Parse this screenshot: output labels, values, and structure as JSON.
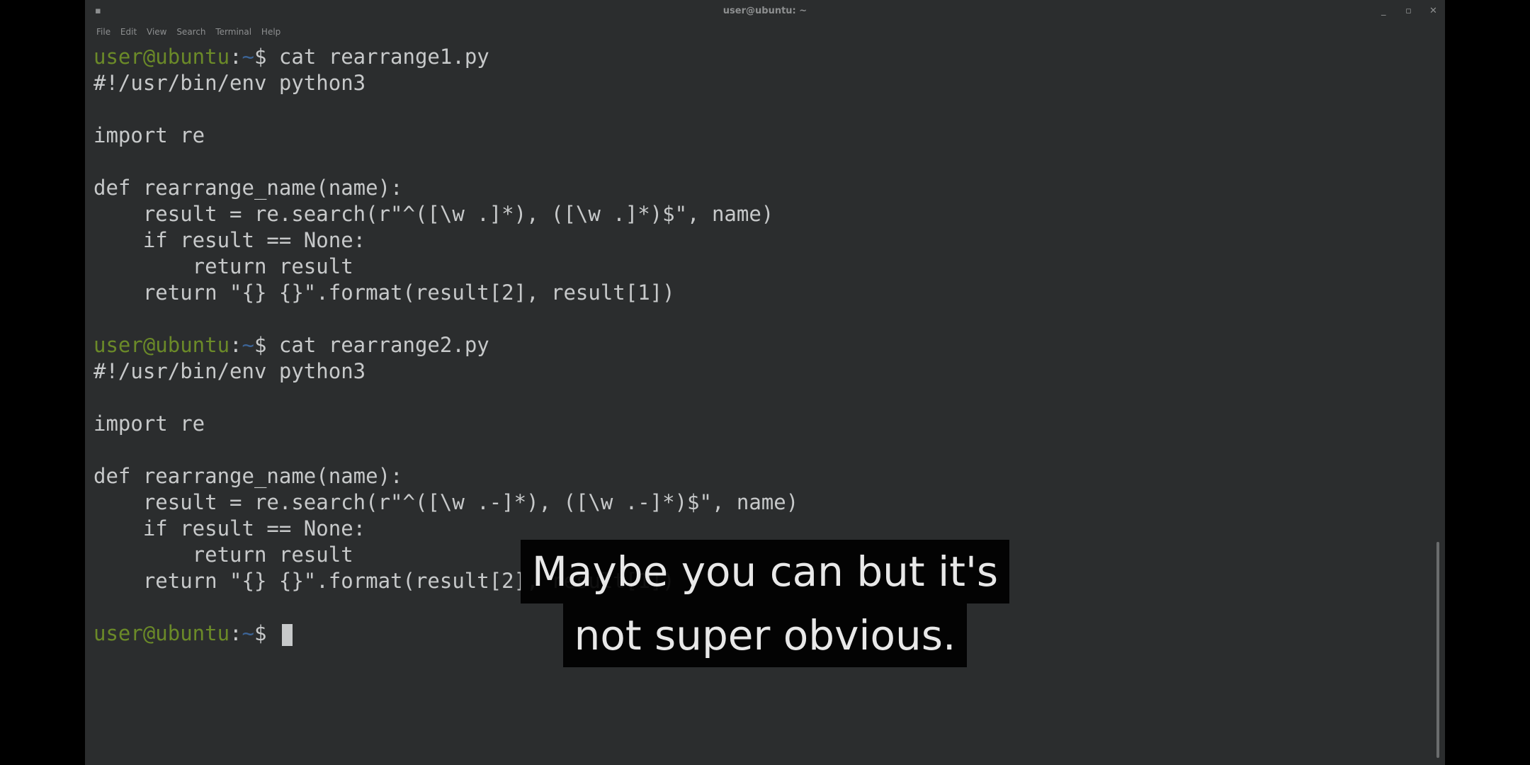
{
  "window": {
    "title": "user@ubuntu: ~",
    "menu": [
      "File",
      "Edit",
      "View",
      "Search",
      "Terminal",
      "Help"
    ],
    "controls": {
      "minimize": "_",
      "maximize": "▫",
      "close": "✕"
    },
    "app_icon": "▪"
  },
  "terminal": {
    "prompt": {
      "user": "user@ubuntu",
      "sep": ":",
      "path": "~",
      "symbol": "$ "
    },
    "block1": {
      "command": "cat rearrange1.py",
      "lines": [
        "#!/usr/bin/env python3",
        "",
        "import re",
        "",
        "def rearrange_name(name):",
        "    result = re.search(r\"^([\\w .]*), ([\\w .]*)$\", name)",
        "    if result == None:",
        "        return result",
        "    return \"{} {}\".format(result[2], result[1])",
        ""
      ]
    },
    "block2": {
      "command": "cat rearrange2.py",
      "lines": [
        "#!/usr/bin/env python3",
        "",
        "import re",
        "",
        "def rearrange_name(name):",
        "    result = re.search(r\"^([\\w .-]*), ([\\w .-]*)$\", name)",
        "    if result == None:",
        "        return result",
        "    return \"{} {}\".format(result[2], result[1])",
        ""
      ]
    }
  },
  "caption": {
    "line1": "Maybe you can but it's",
    "line2": "not super obvious."
  },
  "colors": {
    "background": "#2b2d2e",
    "text": "#c7c9ca",
    "prompt_user": "#6b8a28",
    "prompt_path": "#3c6496"
  }
}
